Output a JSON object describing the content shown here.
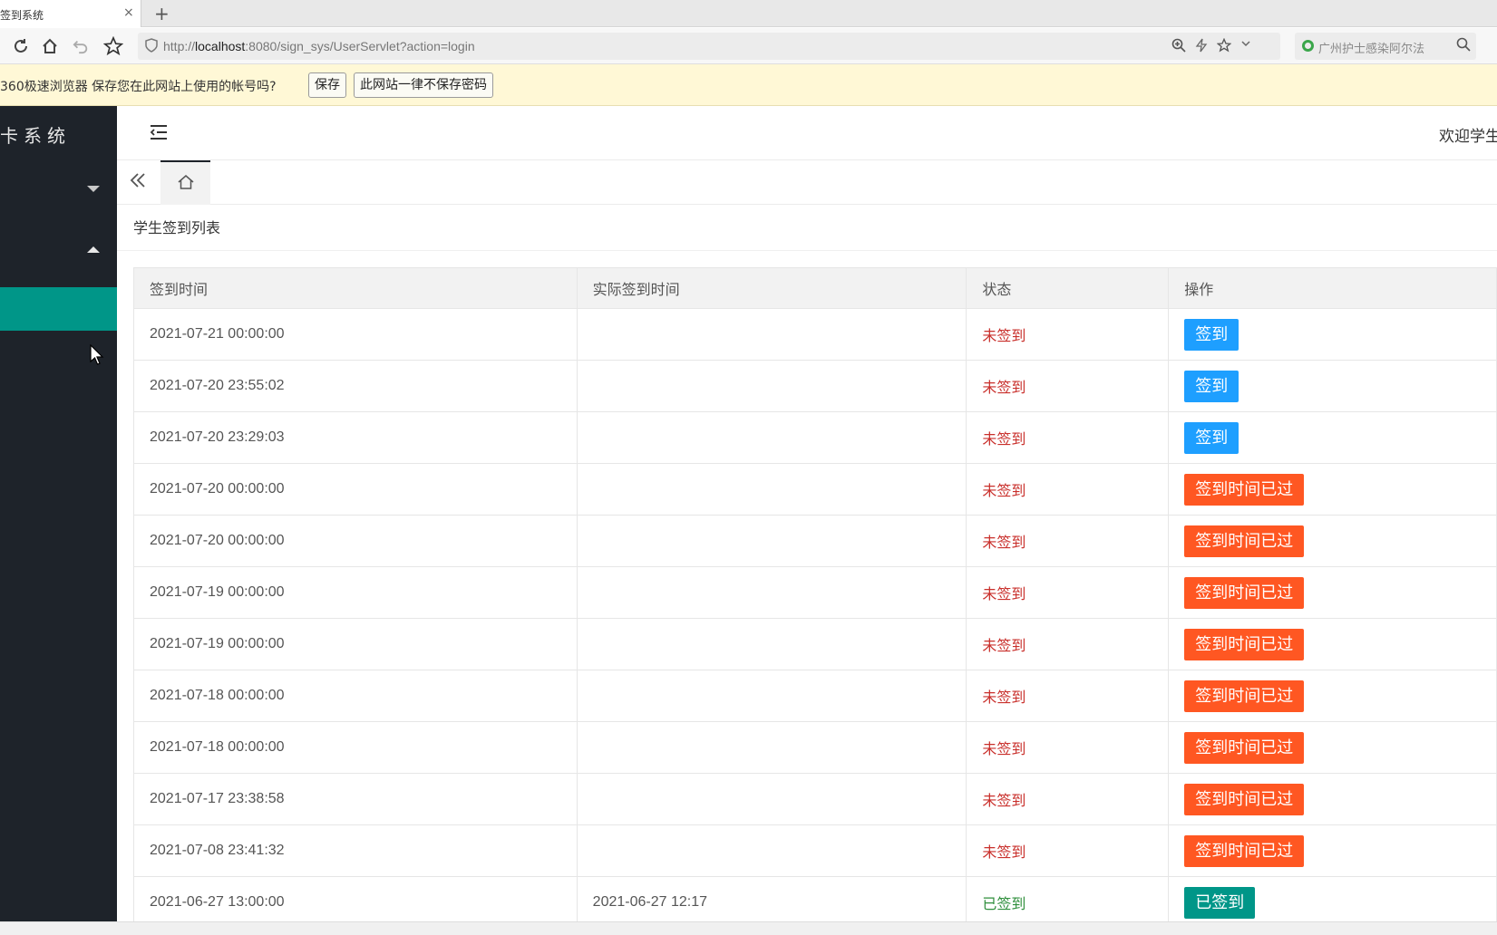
{
  "browser": {
    "tab_title": "签到系统",
    "tab_close": "×",
    "new_tab": "+",
    "url_prefix": "http://",
    "url_host": "localhost",
    "url_rest": ":8080/sign_sys/UserServlet?action=login",
    "search_placeholder": "广州护士感染阿尔法",
    "toolbar_icons": [
      "reload-icon",
      "home-icon",
      "undo-icon",
      "star-icon"
    ]
  },
  "password_bar": {
    "message": "360极速浏览器 保存您在此网站上使用的帐号吗?",
    "save_label": "保存",
    "never_label": "此网站一律不保存密码"
  },
  "sidebar": {
    "logo": "卡系统"
  },
  "header": {
    "welcome": "欢迎学生"
  },
  "page": {
    "title": "学生签到列表"
  },
  "table": {
    "headers": [
      "签到时间",
      "实际签到时间",
      "状态",
      "操作"
    ],
    "rows": [
      {
        "time": "2021-07-21 00:00:00",
        "actual": "",
        "status": "未签到",
        "action": "签到",
        "kind": "blue"
      },
      {
        "time": "2021-07-20 23:55:02",
        "actual": "",
        "status": "未签到",
        "action": "签到",
        "kind": "blue"
      },
      {
        "time": "2021-07-20 23:29:03",
        "actual": "",
        "status": "未签到",
        "action": "签到",
        "kind": "blue"
      },
      {
        "time": "2021-07-20 00:00:00",
        "actual": "",
        "status": "未签到",
        "action": "签到时间已过",
        "kind": "orange"
      },
      {
        "time": "2021-07-20 00:00:00",
        "actual": "",
        "status": "未签到",
        "action": "签到时间已过",
        "kind": "orange"
      },
      {
        "time": "2021-07-19 00:00:00",
        "actual": "",
        "status": "未签到",
        "action": "签到时间已过",
        "kind": "orange"
      },
      {
        "time": "2021-07-19 00:00:00",
        "actual": "",
        "status": "未签到",
        "action": "签到时间已过",
        "kind": "orange"
      },
      {
        "time": "2021-07-18 00:00:00",
        "actual": "",
        "status": "未签到",
        "action": "签到时间已过",
        "kind": "orange"
      },
      {
        "time": "2021-07-18 00:00:00",
        "actual": "",
        "status": "未签到",
        "action": "签到时间已过",
        "kind": "orange"
      },
      {
        "time": "2021-07-17 23:38:58",
        "actual": "",
        "status": "未签到",
        "action": "签到时间已过",
        "kind": "orange"
      },
      {
        "time": "2021-07-08 23:41:32",
        "actual": "",
        "status": "未签到",
        "action": "签到时间已过",
        "kind": "orange"
      },
      {
        "time": "2021-06-27 13:00:00",
        "actual": "2021-06-27 12:17",
        "status": "已签到",
        "action": "已签到",
        "kind": "green"
      }
    ]
  },
  "colors": {
    "sidebar_bg": "#1e232a",
    "active_nav": "#009688",
    "btn_blue": "#1e9fff",
    "btn_orange": "#ff5722",
    "btn_green": "#009688",
    "status_no": "#c9302c",
    "status_yes": "#2f8f3c"
  }
}
